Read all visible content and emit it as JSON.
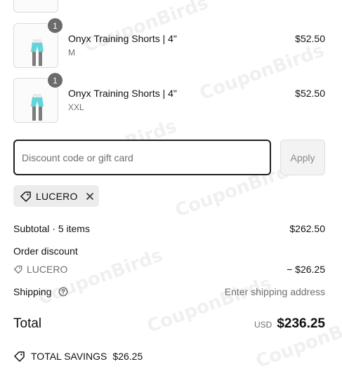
{
  "items": [
    {
      "quantity": "1",
      "title": "Onyx Training Shorts | 4\"",
      "variant": "M",
      "price": "$52.50",
      "image_icon": "shorts-product-image"
    },
    {
      "quantity": "1",
      "title": "Onyx Training Shorts | 4\"",
      "variant": "XXL",
      "price": "$52.50",
      "image_icon": "shorts-product-image"
    }
  ],
  "discount": {
    "placeholder": "Discount code or gift card",
    "value": "",
    "apply_label": "Apply",
    "applied_code": "LUCERO"
  },
  "summary": {
    "subtotal_label": "Subtotal",
    "subtotal_separator": "·",
    "subtotal_items": "5 items",
    "subtotal_value": "$262.50",
    "order_discount_label": "Order discount",
    "discount_code": "LUCERO",
    "discount_value": "− $26.25",
    "shipping_label": "Shipping",
    "shipping_value": "Enter shipping address",
    "total_label": "Total",
    "currency": "USD",
    "total_value": "$236.25",
    "savings_label": "TOTAL SAVINGS",
    "savings_value": "$26.25"
  },
  "watermark": "CouponBirds",
  "colors": {
    "product": "#62d4da",
    "badge": "#6b6b6b",
    "input_border": "#1f1f1f",
    "tag_bg": "#ececec"
  }
}
